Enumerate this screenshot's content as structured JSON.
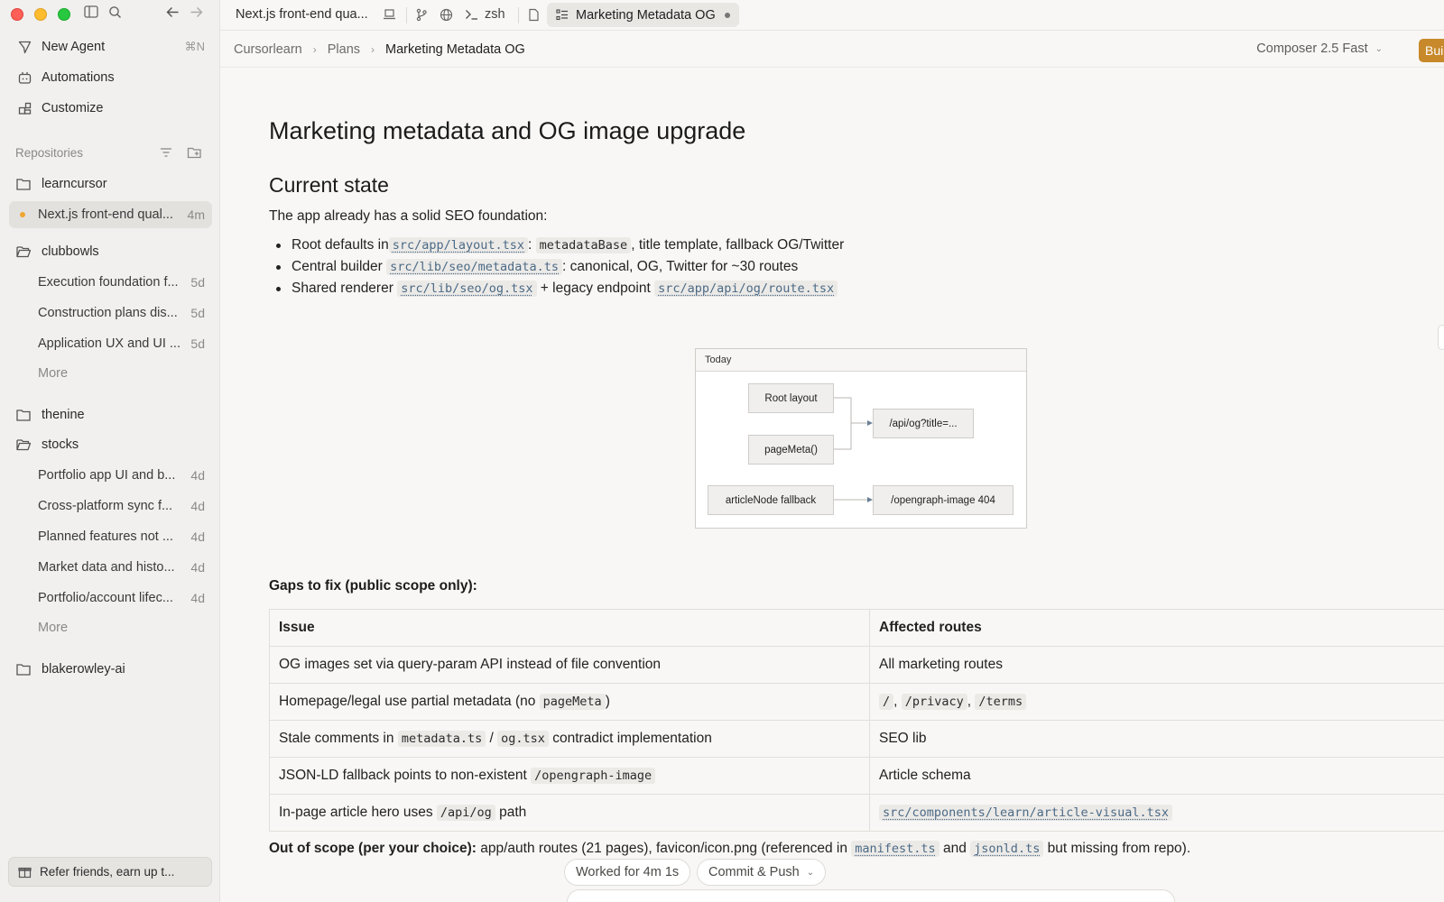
{
  "sidebar": {
    "nav": [
      {
        "label": "New Agent",
        "shortcut": "⌘N",
        "icon": "new-agent-icon"
      },
      {
        "label": "Automations",
        "icon": "automations-icon"
      },
      {
        "label": "Customize",
        "icon": "customize-icon"
      }
    ],
    "repositories_title": "Repositories",
    "repos": [
      {
        "name": "learncursor",
        "threads": [
          {
            "label": "Next.js front-end qual...",
            "time": "4m",
            "active": true
          }
        ]
      },
      {
        "name": "clubbowls",
        "threads": [
          {
            "label": "Execution foundation f...",
            "time": "5d"
          },
          {
            "label": "Construction plans dis...",
            "time": "5d"
          },
          {
            "label": "Application UX and UI ...",
            "time": "5d"
          }
        ],
        "more": "More"
      },
      {
        "name": "thenine",
        "threads": []
      },
      {
        "name": "stocks",
        "threads": [
          {
            "label": "Portfolio app UI and b...",
            "time": "4d"
          },
          {
            "label": "Cross-platform sync f...",
            "time": "4d"
          },
          {
            "label": "Planned features not ...",
            "time": "4d"
          },
          {
            "label": "Market data and histo...",
            "time": "4d"
          },
          {
            "label": "Portfolio/account lifec...",
            "time": "4d"
          }
        ],
        "more": "More"
      },
      {
        "name": "blakerowley-ai",
        "threads": []
      }
    ],
    "refer": "Refer friends, earn up t..."
  },
  "tabbar": {
    "thread_tab": "Next.js front-end qua...",
    "terminal_tab": "zsh",
    "active_tab": "Marketing Metadata OG"
  },
  "breadcrumb": {
    "items": [
      "Cursorlearn",
      "Plans",
      "Marketing Metadata OG"
    ],
    "model": "Composer 2.5 Fast",
    "build": "Build"
  },
  "doc": {
    "title": "Marketing metadata and OG image upgrade",
    "current_state_heading": "Current state",
    "intro": "The app already has a solid SEO foundation:",
    "bullets": {
      "b1_pre": "Root defaults in ",
      "b1_code1": "src/app/layout.tsx",
      "b1_mid": ": ",
      "b1_code2": "metadataBase",
      "b1_post": ", title template, fallback OG/Twitter",
      "b2_pre": "Central builder ",
      "b2_code": "src/lib/seo/metadata.ts",
      "b2_post": ": canonical, OG, Twitter for ~30 routes",
      "b3_pre": "Shared renderer ",
      "b3_code1": "src/lib/seo/og.tsx",
      "b3_mid": " + legacy endpoint ",
      "b3_code2": "src/app/api/og/route.tsx"
    },
    "diagram": {
      "header": "Today",
      "nodes": {
        "root_layout": "Root layout",
        "page_meta": "pageMeta()",
        "api_og": "/api/og?title=...",
        "article_fallback": "articleNode fallback",
        "og_404": "/opengraph-image 404"
      }
    },
    "gaps_title": "Gaps to fix (public scope only):",
    "table": {
      "headers": [
        "Issue",
        "Affected routes"
      ],
      "rows": {
        "r1": {
          "issue": "OG images set via query-param API instead of file convention",
          "routes": "All marketing routes"
        },
        "r2": {
          "issue_pre": "Homepage/legal use partial metadata (no ",
          "issue_code": "pageMeta",
          "issue_post": ")",
          "routes_codes": [
            "/",
            "/privacy",
            "/terms"
          ],
          "sep": ", "
        },
        "r3": {
          "issue_pre": "Stale comments in ",
          "issue_code1": "metadata.ts",
          "issue_mid": " / ",
          "issue_code2": "og.tsx",
          "issue_post": " contradict implementation",
          "routes": "SEO lib"
        },
        "r4": {
          "issue_pre": "JSON-LD fallback points to non-existent ",
          "issue_code": "/opengraph-image",
          "routes": "Article schema"
        },
        "r5": {
          "issue_pre": "In-page article hero uses ",
          "issue_code": "/api/og",
          "issue_post": " path",
          "routes_code": "src/components/learn/article-visual.tsx"
        }
      }
    },
    "out_of_scope": {
      "label": "Out of scope (per your choice):",
      "pre": " app/auth routes (21 pages), favicon/icon.png (referenced in ",
      "code1": "manifest.ts",
      "mid": " and ",
      "code2": "jsonld.ts",
      "post": " but missing from repo)."
    }
  },
  "footer": {
    "worked": "Worked for 4m 1s",
    "commit": "Commit & Push"
  },
  "colors": {
    "accent": "#c8892b",
    "link_code": "#4b6a86",
    "active_dot": "#f0a530"
  }
}
